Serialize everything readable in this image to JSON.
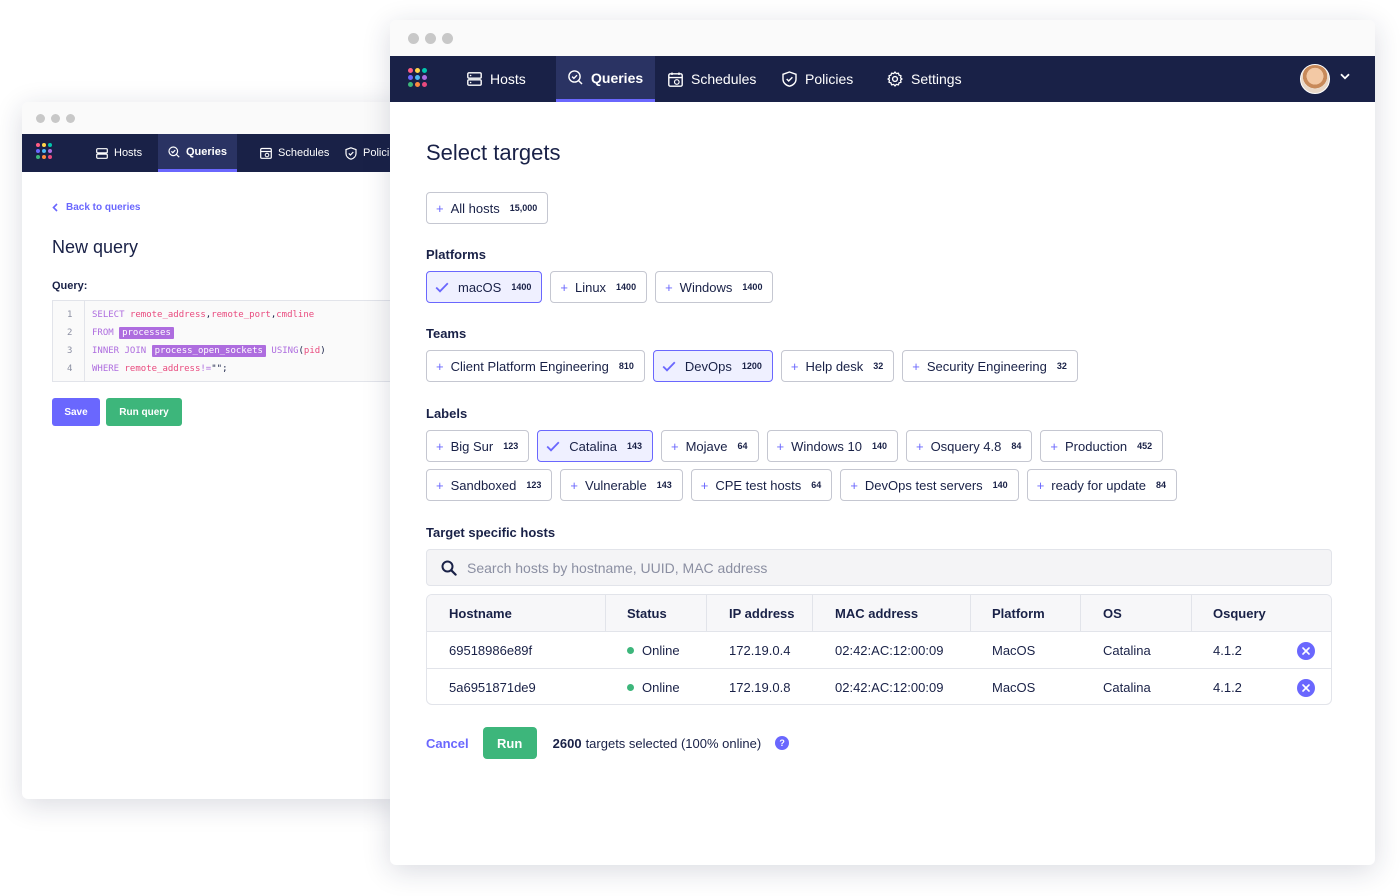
{
  "colors": {
    "nav_bg": "#192147",
    "accent": "#6a67fe",
    "run_green": "#3db67b",
    "online_green": "#3db67b",
    "logo_dots": [
      "#ff5c83",
      "#ffd64a",
      "#00c6ae",
      "#6a67fe",
      "#4bb8f2",
      "#ae6ddf",
      "#3db67b",
      "#ff8a3d",
      "#e94a7e"
    ]
  },
  "back_window": {
    "nav": {
      "items": [
        {
          "label": "Hosts",
          "icon": "hosts-icon"
        },
        {
          "label": "Queries",
          "icon": "queries-icon",
          "active": true
        },
        {
          "label": "Schedules",
          "icon": "schedules-icon"
        },
        {
          "label": "Polici",
          "icon": "policies-icon"
        }
      ]
    },
    "back_link": "Back to queries",
    "title": "New query",
    "query_label": "Query:",
    "code_lines": [
      {
        "n": "1",
        "parts": [
          {
            "t": "SELECT ",
            "c": "kw"
          },
          {
            "t": "remote_address",
            "c": "fn"
          },
          {
            "t": ",",
            "c": ""
          },
          {
            "t": "remote_port",
            "c": "fn"
          },
          {
            "t": ",",
            "c": ""
          },
          {
            "t": "cmdline",
            "c": "fn"
          }
        ]
      },
      {
        "n": "2",
        "parts": [
          {
            "t": "FROM ",
            "c": "kw"
          },
          {
            "t": "processes",
            "c": "tbl"
          }
        ]
      },
      {
        "n": "3",
        "parts": [
          {
            "t": "INNER JOIN ",
            "c": "kw"
          },
          {
            "t": "process_open_sockets",
            "c": "tbl"
          },
          {
            "t": " USING",
            "c": "kw"
          },
          {
            "t": "(",
            "c": ""
          },
          {
            "t": "pid",
            "c": "fn"
          },
          {
            "t": ")",
            "c": ""
          }
        ]
      },
      {
        "n": "4",
        "parts": [
          {
            "t": "WHERE ",
            "c": "kw"
          },
          {
            "t": "remote_address",
            "c": "fn"
          },
          {
            "t": "!=",
            "c": "kw"
          },
          {
            "t": "\"\"",
            "c": ""
          },
          {
            "t": ";",
            "c": ""
          }
        ]
      }
    ],
    "save_label": "Save",
    "run_query_label": "Run query"
  },
  "front_window": {
    "nav": {
      "items": [
        {
          "label": "Hosts",
          "icon": "hosts-icon"
        },
        {
          "label": "Queries",
          "icon": "queries-icon",
          "active": true
        },
        {
          "label": "Schedules",
          "icon": "schedules-icon"
        },
        {
          "label": "Policies",
          "icon": "policies-icon"
        },
        {
          "label": "Settings",
          "icon": "settings-icon"
        }
      ]
    },
    "title": "Select targets",
    "all_hosts": {
      "label": "All hosts",
      "count": "15,000",
      "selected": false
    },
    "platforms_label": "Platforms",
    "platforms": [
      {
        "label": "macOS",
        "count": "1400",
        "selected": true
      },
      {
        "label": "Linux",
        "count": "1400",
        "selected": false
      },
      {
        "label": "Windows",
        "count": "1400",
        "selected": false
      }
    ],
    "teams_label": "Teams",
    "teams": [
      {
        "label": "Client Platform Engineering",
        "count": "810",
        "selected": false
      },
      {
        "label": "DevOps",
        "count": "1200",
        "selected": true
      },
      {
        "label": "Help desk",
        "count": "32",
        "selected": false
      },
      {
        "label": "Security Engineering",
        "count": "32",
        "selected": false
      }
    ],
    "labels_label": "Labels",
    "labels_row1": [
      {
        "label": "Big Sur",
        "count": "123",
        "selected": false
      },
      {
        "label": "Catalina",
        "count": "143",
        "selected": true
      },
      {
        "label": "Mojave",
        "count": "64",
        "selected": false
      },
      {
        "label": "Windows 10",
        "count": "140",
        "selected": false
      },
      {
        "label": "Osquery 4.8",
        "count": "84",
        "selected": false
      },
      {
        "label": "Production",
        "count": "452",
        "selected": false
      }
    ],
    "labels_row2": [
      {
        "label": "Sandboxed",
        "count": "123",
        "selected": false
      },
      {
        "label": "Vulnerable",
        "count": "143",
        "selected": false
      },
      {
        "label": "CPE test hosts",
        "count": "64",
        "selected": false
      },
      {
        "label": "DevOps test servers",
        "count": "140",
        "selected": false
      },
      {
        "label": "ready for update",
        "count": "84",
        "selected": false
      }
    ],
    "specific_hosts_label": "Target specific hosts",
    "search_placeholder": "Search hosts by hostname, UUID, MAC address",
    "table": {
      "columns": [
        "Hostname",
        "Status",
        "IP address",
        "MAC address",
        "Platform",
        "OS",
        "Osquery"
      ],
      "rows": [
        {
          "hostname": "69518986e89f",
          "status": "Online",
          "ip": "172.19.0.4",
          "mac": "02:42:AC:12:00:09",
          "platform": "MacOS",
          "os": "Catalina",
          "osquery": "4.1.2"
        },
        {
          "hostname": "5a6951871de9",
          "status": "Online",
          "ip": "172.19.0.8",
          "mac": "02:42:AC:12:00:09",
          "platform": "MacOS",
          "os": "Catalina",
          "osquery": "4.1.2"
        }
      ]
    },
    "footer": {
      "cancel": "Cancel",
      "run": "Run",
      "targets_count": "2600",
      "targets_text": "targets selected (100% online)",
      "help": "?"
    }
  }
}
